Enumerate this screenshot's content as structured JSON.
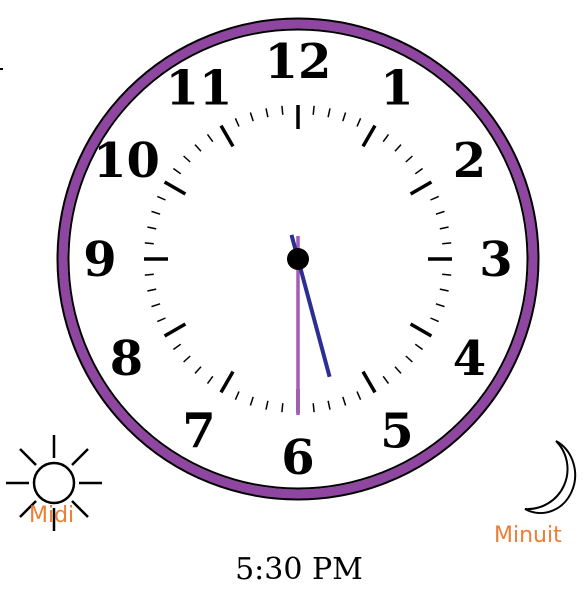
{
  "clock": {
    "numerals": [
      "12",
      "1",
      "2",
      "3",
      "4",
      "5",
      "6",
      "7",
      "8",
      "9",
      "10",
      "11"
    ],
    "hour": 5,
    "minute": 30,
    "rim_color": "#8e46a1",
    "hour_hand_color": "#2b2f93",
    "minute_hand_color": "#a55cb4",
    "dial_color": "#ffffff"
  },
  "labels": {
    "noon": "Midi",
    "midnight": "Minuit",
    "label_color": "#ee7e33"
  },
  "icons": {
    "noon_icon": "sun-icon",
    "midnight_icon": "crescent-moon-icon"
  },
  "caption": {
    "time_text": "5:30 PM"
  }
}
